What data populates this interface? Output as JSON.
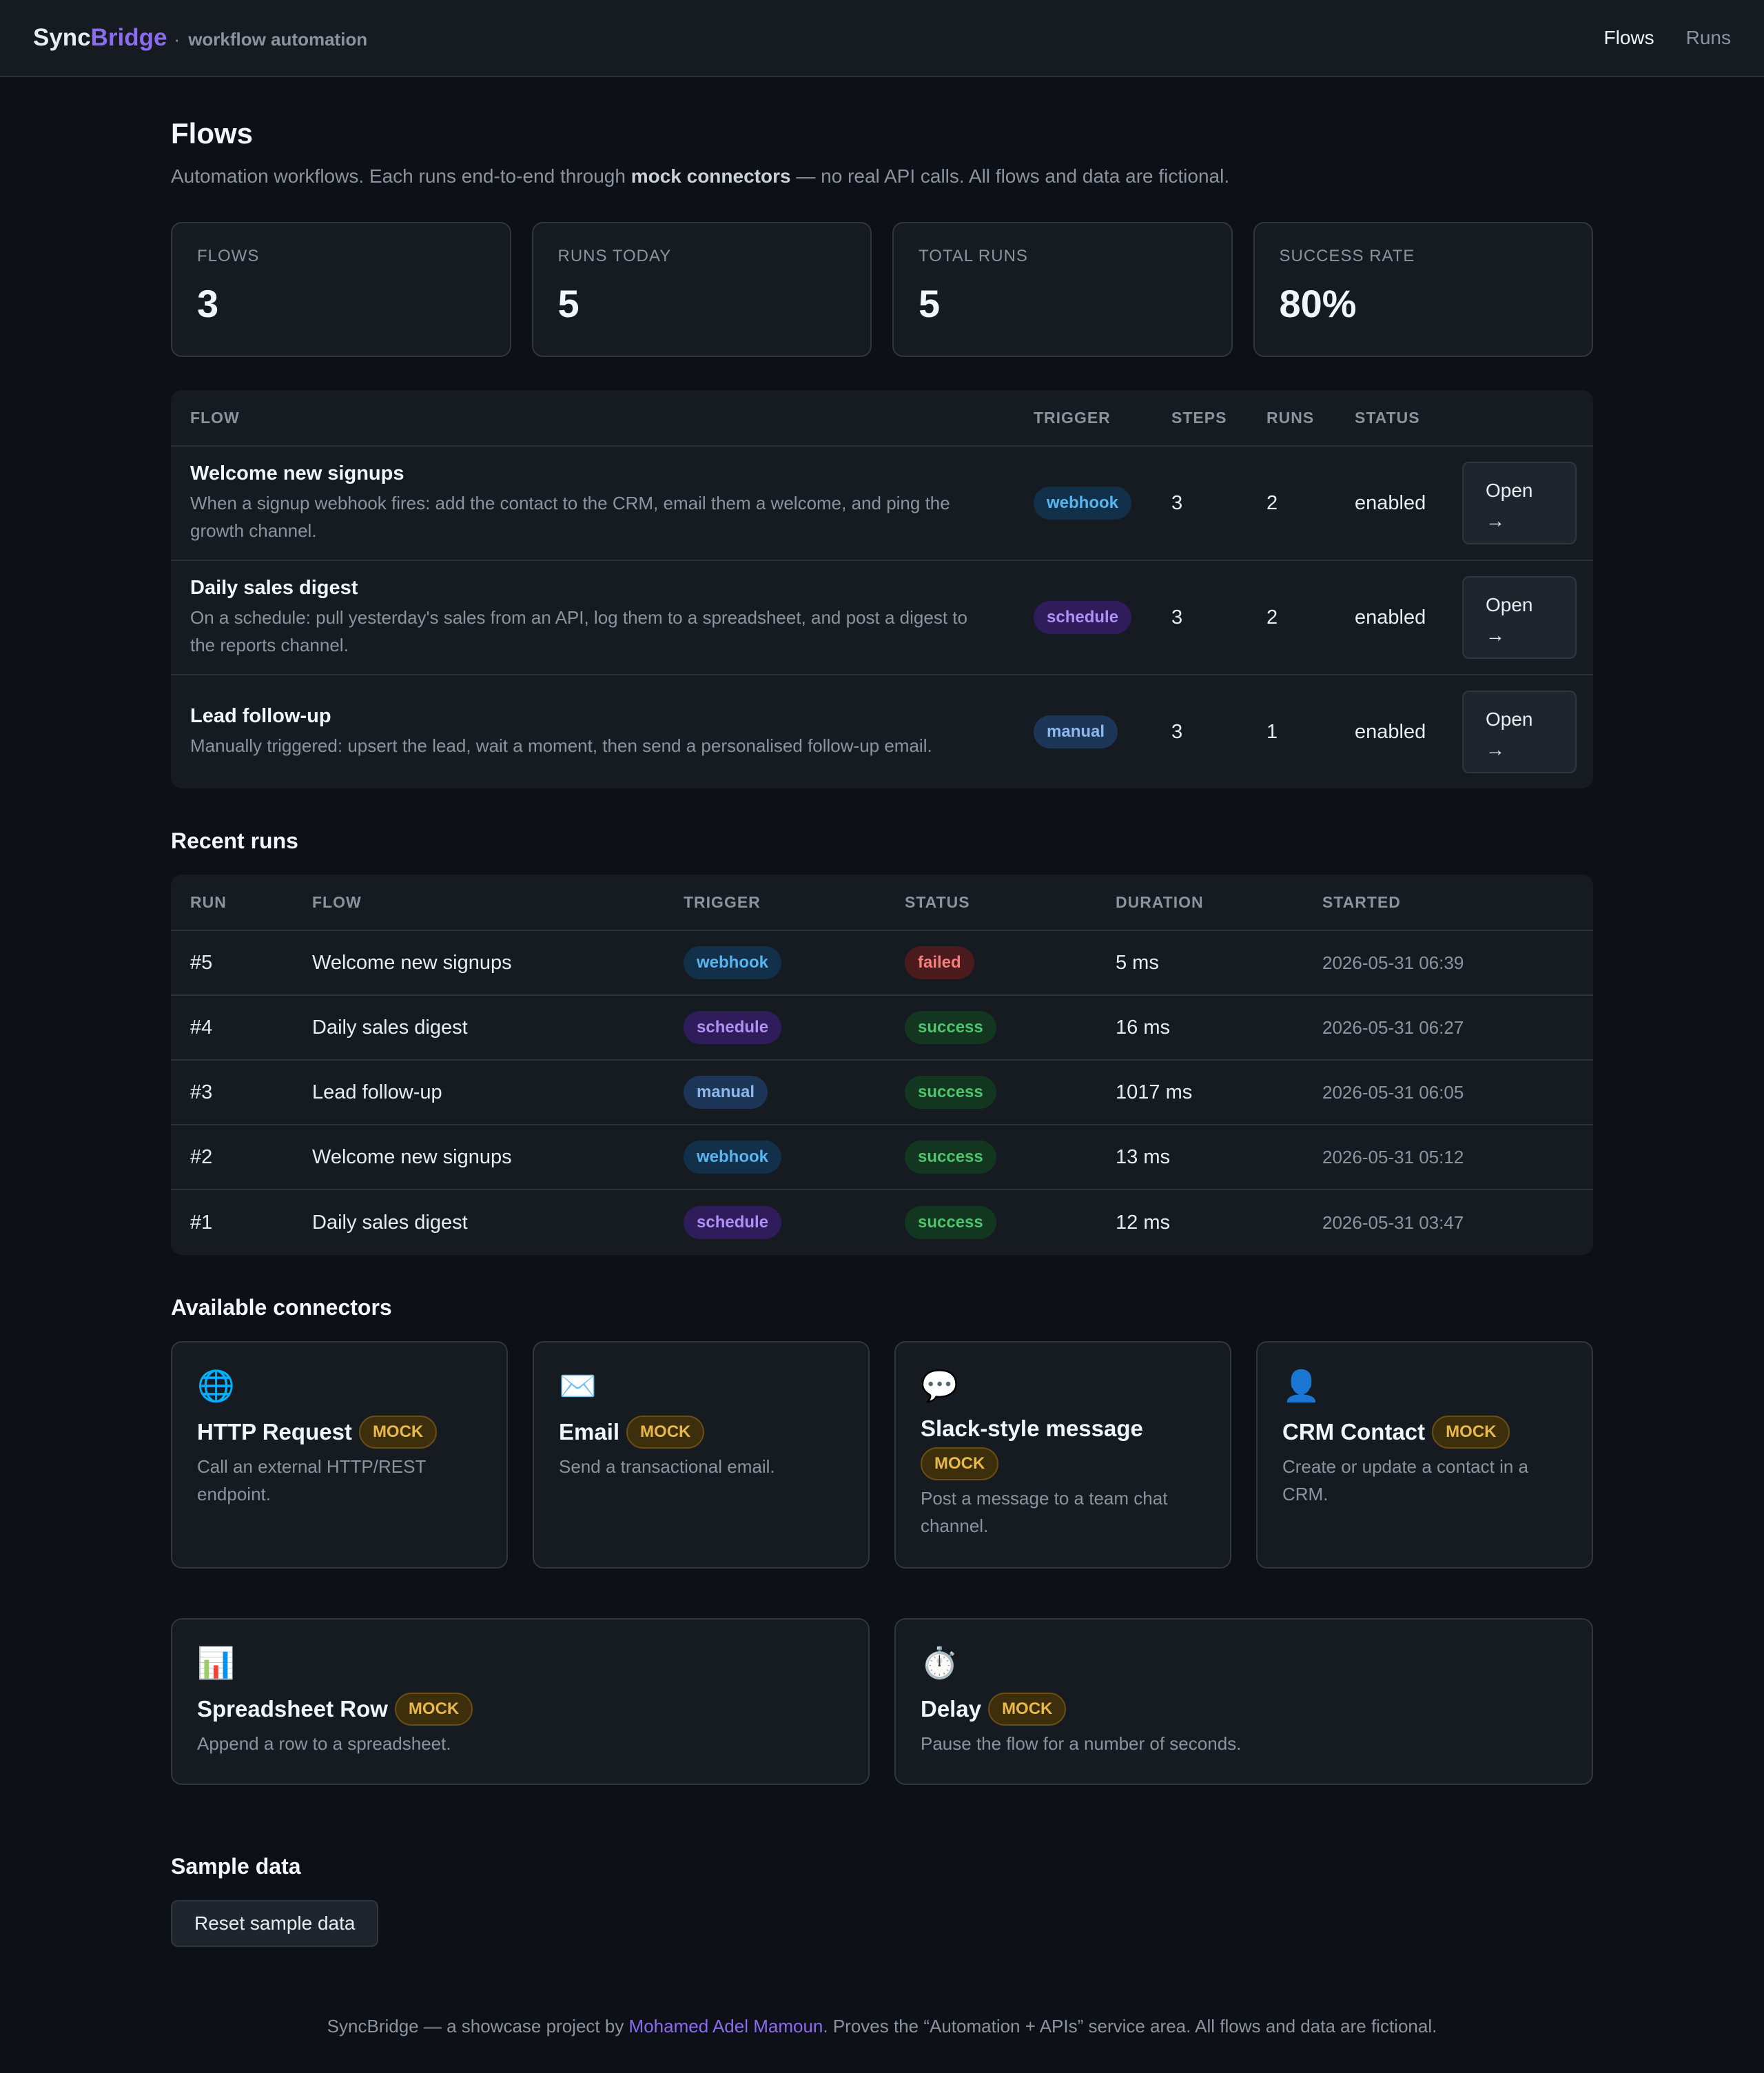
{
  "header": {
    "brand_first": "Sync",
    "brand_second": "Bridge",
    "separator": "·",
    "tagline": "workflow automation",
    "nav": [
      "Flows",
      "Runs"
    ]
  },
  "page": {
    "title": "Flows",
    "subtitle_pre": "Automation workflows. Each runs end-to-end through ",
    "subtitle_bold": "mock connectors",
    "subtitle_post": " — no real API calls. All flows and data are fictional."
  },
  "stats": [
    {
      "label": "FLOWS",
      "value": "3"
    },
    {
      "label": "RUNS TODAY",
      "value": "5"
    },
    {
      "label": "TOTAL RUNS",
      "value": "5"
    },
    {
      "label": "SUCCESS RATE",
      "value": "80%"
    }
  ],
  "flows_table": {
    "headers": [
      "FLOW",
      "TRIGGER",
      "STEPS",
      "RUNS",
      "STATUS",
      ""
    ],
    "rows": [
      {
        "name": "Welcome new signups",
        "desc": "When a signup webhook fires: add the contact to the CRM, email them a welcome, and ping the growth channel.",
        "trigger": "webhook",
        "steps": "3",
        "runs": "2",
        "status": "enabled",
        "action": "Open →"
      },
      {
        "name": "Daily sales digest",
        "desc": "On a schedule: pull yesterday's sales from an API, log them to a spreadsheet, and post a digest to the reports channel.",
        "trigger": "schedule",
        "steps": "3",
        "runs": "2",
        "status": "enabled",
        "action": "Open →"
      },
      {
        "name": "Lead follow-up",
        "desc": "Manually triggered: upsert the lead, wait a moment, then send a personalised follow-up email.",
        "trigger": "manual",
        "steps": "3",
        "runs": "1",
        "status": "enabled",
        "action": "Open →"
      }
    ]
  },
  "recent_runs": {
    "title": "Recent runs",
    "headers": [
      "RUN",
      "FLOW",
      "TRIGGER",
      "STATUS",
      "DURATION",
      "STARTED"
    ],
    "rows": [
      {
        "run": "#5",
        "flow": "Welcome new signups",
        "trigger": "webhook",
        "status": "failed",
        "duration": "5 ms",
        "started": "2026-05-31 06:39"
      },
      {
        "run": "#4",
        "flow": "Daily sales digest",
        "trigger": "schedule",
        "status": "success",
        "duration": "16 ms",
        "started": "2026-05-31 06:27"
      },
      {
        "run": "#3",
        "flow": "Lead follow-up",
        "trigger": "manual",
        "status": "success",
        "duration": "1017 ms",
        "started": "2026-05-31 06:05"
      },
      {
        "run": "#2",
        "flow": "Welcome new signups",
        "trigger": "webhook",
        "status": "success",
        "duration": "13 ms",
        "started": "2026-05-31 05:12"
      },
      {
        "run": "#1",
        "flow": "Daily sales digest",
        "trigger": "schedule",
        "status": "success",
        "duration": "12 ms",
        "started": "2026-05-31 03:47"
      }
    ]
  },
  "connectors": {
    "title": "Available connectors",
    "badge": "MOCK",
    "items": [
      {
        "icon": "globe-icon",
        "glyph": "🌐",
        "name": "HTTP Request",
        "desc": "Call an external HTTP/REST endpoint."
      },
      {
        "icon": "envelope-icon",
        "glyph": "✉️",
        "name": "Email",
        "desc": "Send a transactional email."
      },
      {
        "icon": "speech-bubble-icon",
        "glyph": "💬",
        "name": "Slack-style message",
        "desc": "Post a message to a team chat channel."
      },
      {
        "icon": "person-icon",
        "glyph": "👤",
        "name": "CRM Contact",
        "desc": "Create or update a contact in a CRM."
      },
      {
        "icon": "bar-chart-icon",
        "glyph": "📊",
        "name": "Spreadsheet Row",
        "desc": "Append a row to a spreadsheet."
      },
      {
        "icon": "stopwatch-icon",
        "glyph": "⏱️",
        "name": "Delay",
        "desc": "Pause the flow for a number of seconds."
      }
    ]
  },
  "sample": {
    "title": "Sample data",
    "reset_label": "Reset sample data"
  },
  "footer": {
    "pre": "SyncBridge — a showcase project by ",
    "link": "Mohamed Adel Mamoun",
    "post": ". Proves the “Automation + APIs” service area. All flows and data are fictional."
  },
  "colors": {
    "background": "#0d1117",
    "surface": "#161b22",
    "accent": "#8b6cf0",
    "success": "#4fc46c",
    "failed": "#f57f7a",
    "mock": "#e9b84a"
  }
}
